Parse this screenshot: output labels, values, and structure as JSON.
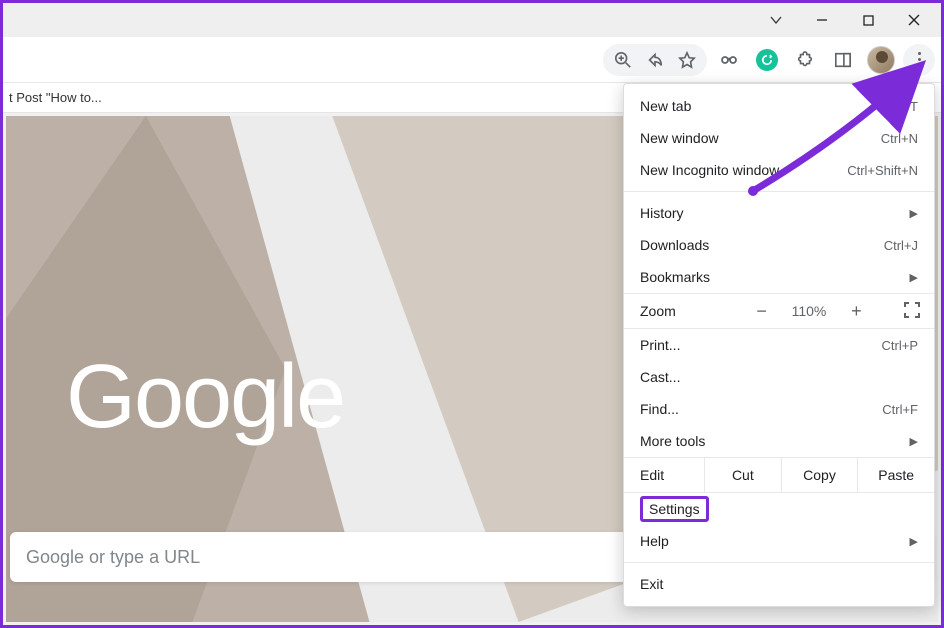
{
  "window": {
    "title": ""
  },
  "bookmarks": {
    "item1": "t Post \"How to..."
  },
  "content": {
    "logo_text": "Google",
    "omnibox_placeholder": "Google or type a URL"
  },
  "menu": {
    "new_tab": {
      "label": "New tab",
      "shortcut": "Ctrl+T"
    },
    "new_window": {
      "label": "New window",
      "shortcut": "Ctrl+N"
    },
    "new_incognito": {
      "label": "New Incognito window",
      "shortcut": "Ctrl+Shift+N"
    },
    "history": {
      "label": "History"
    },
    "downloads": {
      "label": "Downloads",
      "shortcut": "Ctrl+J"
    },
    "bookmarks": {
      "label": "Bookmarks"
    },
    "zoom": {
      "label": "Zoom",
      "level": "110%"
    },
    "print": {
      "label": "Print...",
      "shortcut": "Ctrl+P"
    },
    "cast": {
      "label": "Cast..."
    },
    "find": {
      "label": "Find...",
      "shortcut": "Ctrl+F"
    },
    "more_tools": {
      "label": "More tools"
    },
    "edit": {
      "label": "Edit",
      "cut": "Cut",
      "copy": "Copy",
      "paste": "Paste"
    },
    "settings": {
      "label": "Settings"
    },
    "help": {
      "label": "Help"
    },
    "exit": {
      "label": "Exit"
    }
  }
}
